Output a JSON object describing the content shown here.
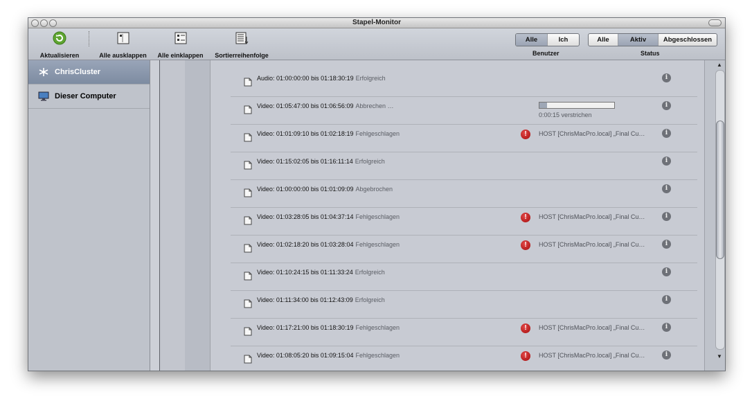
{
  "window": {
    "title": "Stapel-Monitor"
  },
  "toolbar": {
    "refresh_label": "Aktualisieren",
    "expand_label": "Alle ausklappen",
    "collapse_label": "Alle einklappen",
    "sort_label": "Sortierreihenfolge",
    "user_filter": {
      "title": "Benutzer",
      "options": [
        "Alle",
        "Ich"
      ],
      "selected": "Alle"
    },
    "status_filter": {
      "title": "Status",
      "options": [
        "Alle",
        "Aktiv",
        "Abgeschlossen"
      ],
      "selected": "Aktiv"
    }
  },
  "sidebar": {
    "items": [
      {
        "label": "ChrisCluster",
        "icon": "cluster-icon",
        "selected": true
      },
      {
        "label": "Dieser Computer",
        "icon": "computer-icon",
        "selected": false
      }
    ]
  },
  "tasks": [
    {
      "title": "Audio: 01:00:00:00 bis 01:18:30:19",
      "status": "Erfolgreich"
    },
    {
      "title": "Video: 01:05:47:00 bis 01:06:56:09",
      "status": "Abbrechen …",
      "progress": 0.1,
      "elapsed": "0:00:15 verstrichen"
    },
    {
      "title": "Video: 01:01:09:10 bis 01:02:18:19",
      "status": "Fehlgeschlagen",
      "error": true,
      "detail": "HOST [ChrisMacPro.local] „Final Cu…"
    },
    {
      "title": "Video: 01:15:02:05 bis 01:16:11:14",
      "status": "Erfolgreich"
    },
    {
      "title": "Video: 01:00:00:00 bis 01:01:09:09",
      "status": "Abgebrochen"
    },
    {
      "title": "Video: 01:03:28:05 bis 01:04:37:14",
      "status": "Fehlgeschlagen",
      "error": true,
      "detail": "HOST [ChrisMacPro.local] „Final Cu…"
    },
    {
      "title": "Video: 01:02:18:20 bis 01:03:28:04",
      "status": "Fehlgeschlagen",
      "error": true,
      "detail": "HOST [ChrisMacPro.local] „Final Cu…"
    },
    {
      "title": "Video: 01:10:24:15 bis 01:11:33:24",
      "status": "Erfolgreich"
    },
    {
      "title": "Video: 01:11:34:00 bis 01:12:43:09",
      "status": "Erfolgreich"
    },
    {
      "title": "Video: 01:17:21:00 bis 01:18:30:19",
      "status": "Fehlgeschlagen",
      "error": true,
      "detail": "HOST [ChrisMacPro.local] „Final Cu…"
    },
    {
      "title": "Video: 01:08:05:20 bis 01:09:15:04",
      "status": "Fehlgeschlagen",
      "error": true,
      "detail": "HOST [ChrisMacPro.local] „Final Cu…"
    }
  ]
}
